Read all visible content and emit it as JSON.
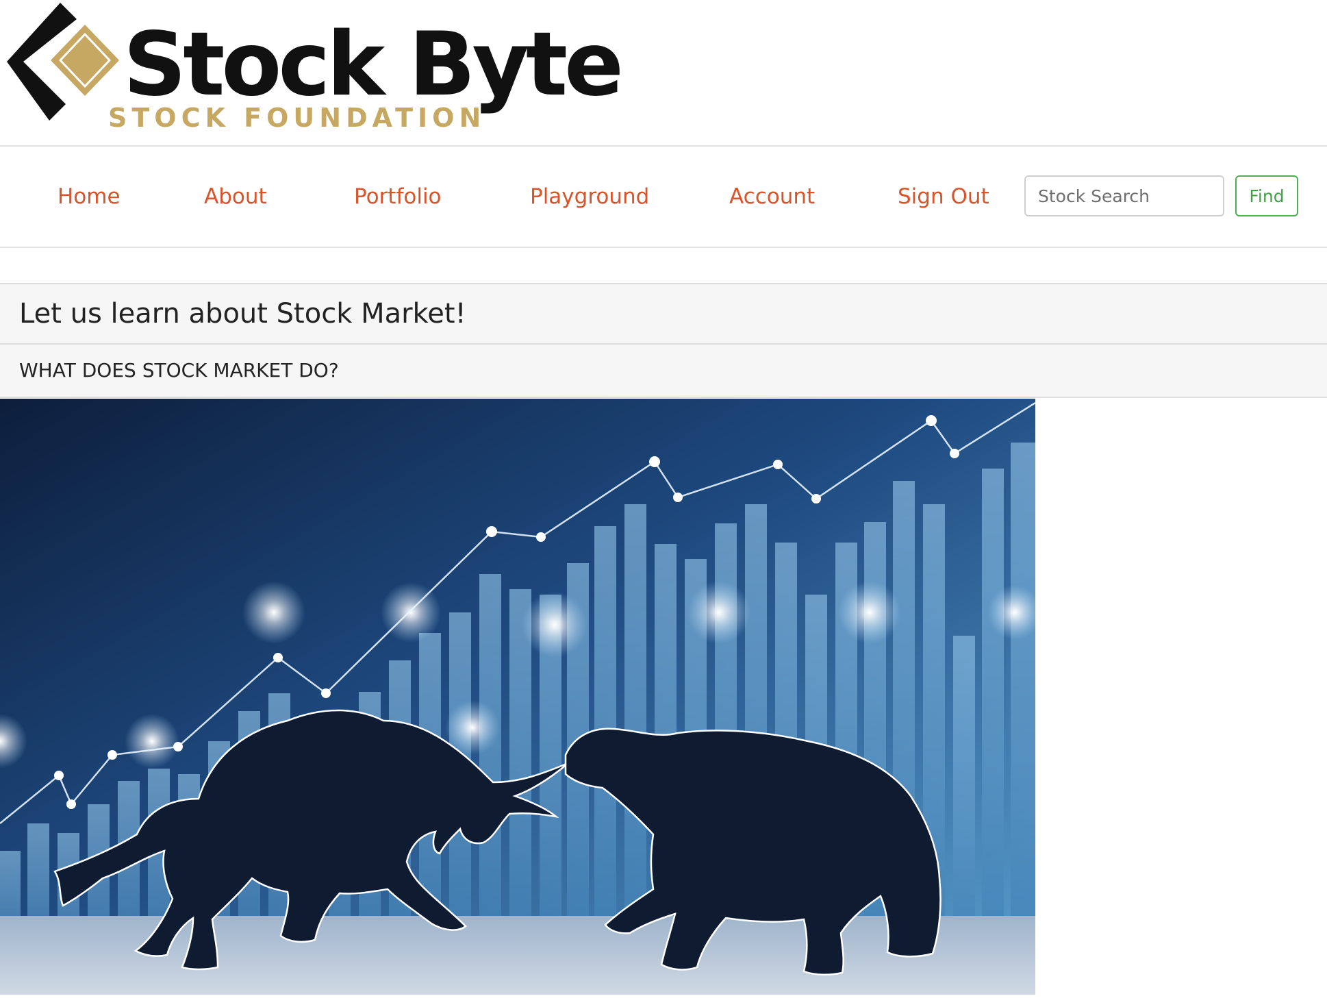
{
  "brand": {
    "name": "Stock Byte",
    "tagline": "STOCK FOUNDATION",
    "colors": {
      "gold": "#c6a862",
      "dark": "#111111"
    }
  },
  "nav": {
    "items": [
      {
        "label": "Home"
      },
      {
        "label": "About"
      },
      {
        "label": "Portfolio"
      },
      {
        "label": "Playground"
      },
      {
        "label": "Account"
      },
      {
        "label": "Sign Out"
      }
    ],
    "link_color": "#d8542b",
    "search": {
      "placeholder": "Stock Search",
      "value": ""
    },
    "find_label": "Find",
    "find_color": "#43a047"
  },
  "main": {
    "title": "Let us learn about Stock Market!",
    "section_title": "WHAT DOES STOCK MARKET DO?",
    "hero_image": {
      "subject": "bull-vs-bear-stock-chart",
      "colors": {
        "background": "#1e3f6e",
        "silhouette": "#0f1b30",
        "glow": "#ffffff"
      }
    }
  }
}
